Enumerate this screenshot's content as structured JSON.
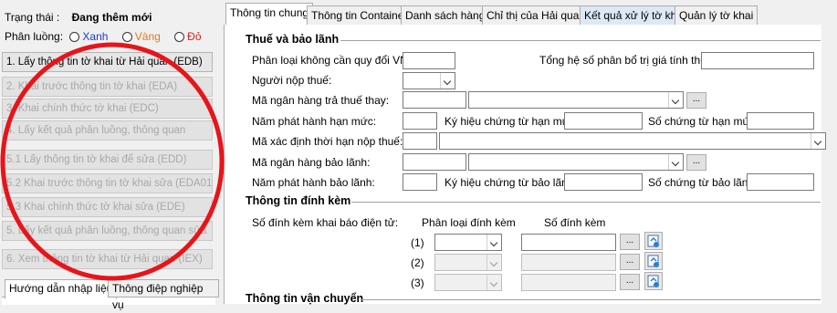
{
  "left": {
    "status_label": "Trạng thái :",
    "status_value": "Đang thêm mới",
    "flow_label": "Phân luồng:",
    "flow_options": [
      "Xanh",
      "Vàng",
      "Đỏ"
    ],
    "flow_colors": [
      "#1a3fd1",
      "#e07a1f",
      "#e01a1a"
    ],
    "steps": [
      "1. Lấy thông tin tờ khai từ Hải quan (EDB)",
      "2. Khai trước thông tin tờ khai (EDA)",
      "3. Khai chính thức tờ khai (EDC)",
      "4. Lấy kết quả phân luồng, thông quan",
      "5.1 Lấy thông tin tờ khai để sửa (EDD)",
      "5.2 Khai trước thông tin tờ khai sửa (EDA01)",
      "5.3 Khai chính thức tờ khai sửa (EDE)",
      "5. Lấy kết quả phân luồng, thông quan sửa",
      "6. Xem thông tin tờ khai từ Hải quan (IEX)"
    ],
    "bottom_tabs": [
      "Hướng dẫn nhập liệu",
      "Thông điệp nghiệp vụ"
    ]
  },
  "tabs": [
    "Thông tin chung",
    "Thông tin Container",
    "Danh sách hàng",
    "Chỉ thị của Hải quan",
    "Kết quả xử lý tờ khai",
    "Quản lý tờ khai"
  ],
  "sections": {
    "tax": "Thuế và bảo lãnh",
    "attach": "Thông tin đính kèm",
    "transport": "Thông tin vận chuyển"
  },
  "fields": {
    "phan_loai": "Phân loại không cần quy đổi VNĐ:",
    "tong_he_so": "Tổng hệ số phân bổ trị giá tính thuế:",
    "nguoi_nop": "Người nộp thuế:",
    "ma_nh_tra": "Mã ngân hàng trả thuế thay:",
    "nam_han_muc": "Năm phát hành hạn mức:",
    "ky_hieu_han_muc": "Ký hiệu chứng từ hạn mức:",
    "so_han_muc": "Số chứng từ hạn mức:",
    "ma_thoi_han": "Mã xác định thời hạn nộp thuế:",
    "ma_nh_bao_lanh": "Mã ngân hàng bảo lãnh:",
    "nam_bao_lanh": "Năm phát hành bảo lãnh:",
    "ky_hieu_bao_lanh": "Ký hiệu chứng từ bảo lãnh:",
    "so_bao_lanh": "Số chứng từ bảo lãnh:",
    "dots": "..."
  },
  "attach": {
    "so_dinh_kem": "Số đính kèm khai báo điện tử:",
    "col_phan_loai": "Phân loại đính kèm",
    "col_so": "Số đính kèm",
    "rows": [
      "(1)",
      "(2)",
      "(3)"
    ]
  }
}
